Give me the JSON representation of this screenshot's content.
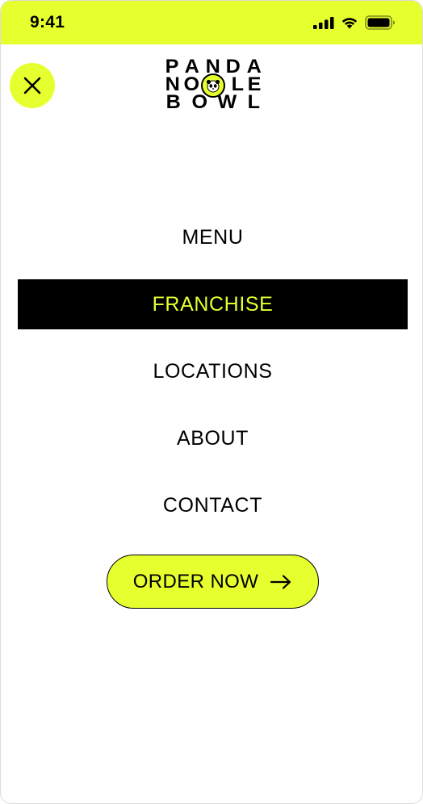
{
  "status_bar": {
    "time": "9:41",
    "background_color": "#e6ff2e",
    "icons": [
      "cellular-signal-icon",
      "wifi-icon",
      "battery-icon"
    ]
  },
  "header": {
    "close_icon": "close-icon",
    "logo": {
      "line1": [
        "P",
        "A",
        "N",
        "D",
        "A"
      ],
      "line2": [
        "N",
        "O",
        "",
        "L",
        "E"
      ],
      "line3": [
        "B",
        "O",
        "W",
        "L"
      ]
    }
  },
  "nav": {
    "items": [
      {
        "label": "MENU",
        "active": false
      },
      {
        "label": "FRANCHISE",
        "active": true
      },
      {
        "label": "LOCATIONS",
        "active": false
      },
      {
        "label": "ABOUT",
        "active": false
      },
      {
        "label": "CONTACT",
        "active": false
      }
    ]
  },
  "cta": {
    "label": "ORDER NOW",
    "icon": "arrow-right-icon"
  },
  "colors": {
    "accent": "#e6ff2e",
    "active_bg": "#000000",
    "text": "#000000"
  }
}
